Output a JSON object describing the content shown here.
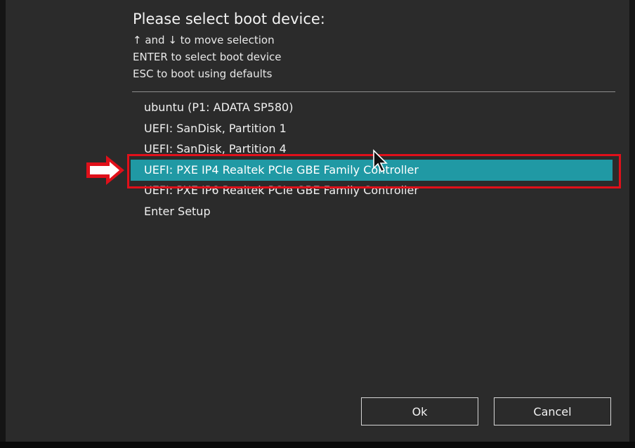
{
  "dialog": {
    "title": "Please select boot device:",
    "help": [
      "↑ and ↓ to move selection",
      "ENTER to select boot device",
      "ESC to boot using defaults"
    ]
  },
  "boot_devices": [
    "ubuntu (P1: ADATA SP580)",
    "UEFI: SanDisk, Partition 1",
    "UEFI: SanDisk, Partition 4",
    "UEFI: PXE IP4 Realtek PCIe GBE Family Controller",
    "UEFI: PXE IP6 Realtek PCIe GBE Family Controller",
    "Enter Setup"
  ],
  "selected_index": 3,
  "buttons": {
    "ok": "Ok",
    "cancel": "Cancel"
  },
  "colors": {
    "background": "#2b2b2b",
    "selection": "#2099a4",
    "annotation": "#e0101a"
  },
  "icons": {
    "pointer": "right-arrow-icon",
    "cursor": "mouse-cursor-icon"
  }
}
